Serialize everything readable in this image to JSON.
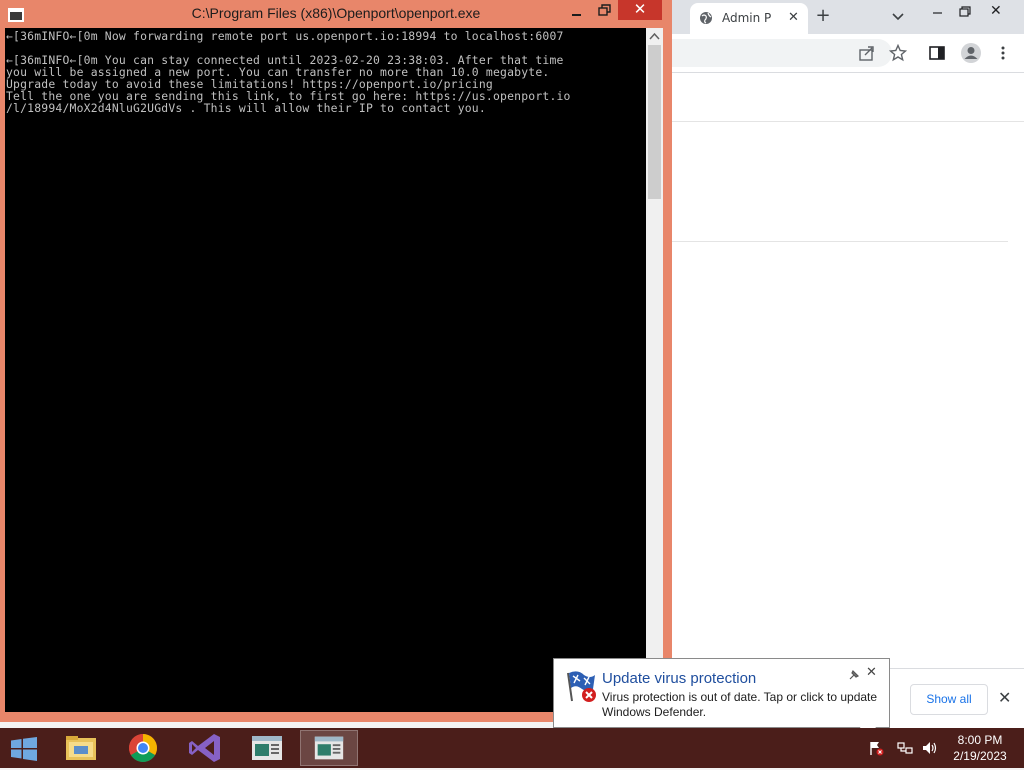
{
  "console": {
    "title": "C:\\Program Files (x86)\\Openport\\openport.exe",
    "close_glyph": "✕",
    "lines": [
      "←[36mINFO←[0m Now forwarding remote port us.openport.io:18994 to localhost:6007",
      "",
      "←[36mINFO←[0m You can stay connected until 2023-02-20 23:38:03. After that time",
      "you will be assigned a new port. You can transfer no more than 10.0 megabyte.",
      "Upgrade today to avoid these limitations! https://openport.io/pricing",
      "Tell the one you are sending this link, to first go here: https://us.openport.io",
      "/l/18994/MoX2d4NluG2UGdVs . This will allow their IP to contact you."
    ]
  },
  "chrome": {
    "tab_title": "Admin P",
    "tab_close": "✕",
    "new_tab": "+",
    "window_close": "✕",
    "download_bar": {
      "show_all": "Show all",
      "close": "✕"
    }
  },
  "toast": {
    "title": "Update virus protection",
    "body": "Virus protection is out of date. Tap or click to update Windows Defender.",
    "close": "✕"
  },
  "taskbar": {
    "time": "8:00 PM",
    "date": "2/19/2023",
    "apps": [
      "file-explorer",
      "chrome",
      "visual-studio",
      "console-window",
      "console-window-active"
    ]
  },
  "colors": {
    "console_frame": "#e8866a",
    "taskbar": "#4b1e1a",
    "toast_title": "#1f4e9e",
    "close_red": "#c7362b"
  }
}
